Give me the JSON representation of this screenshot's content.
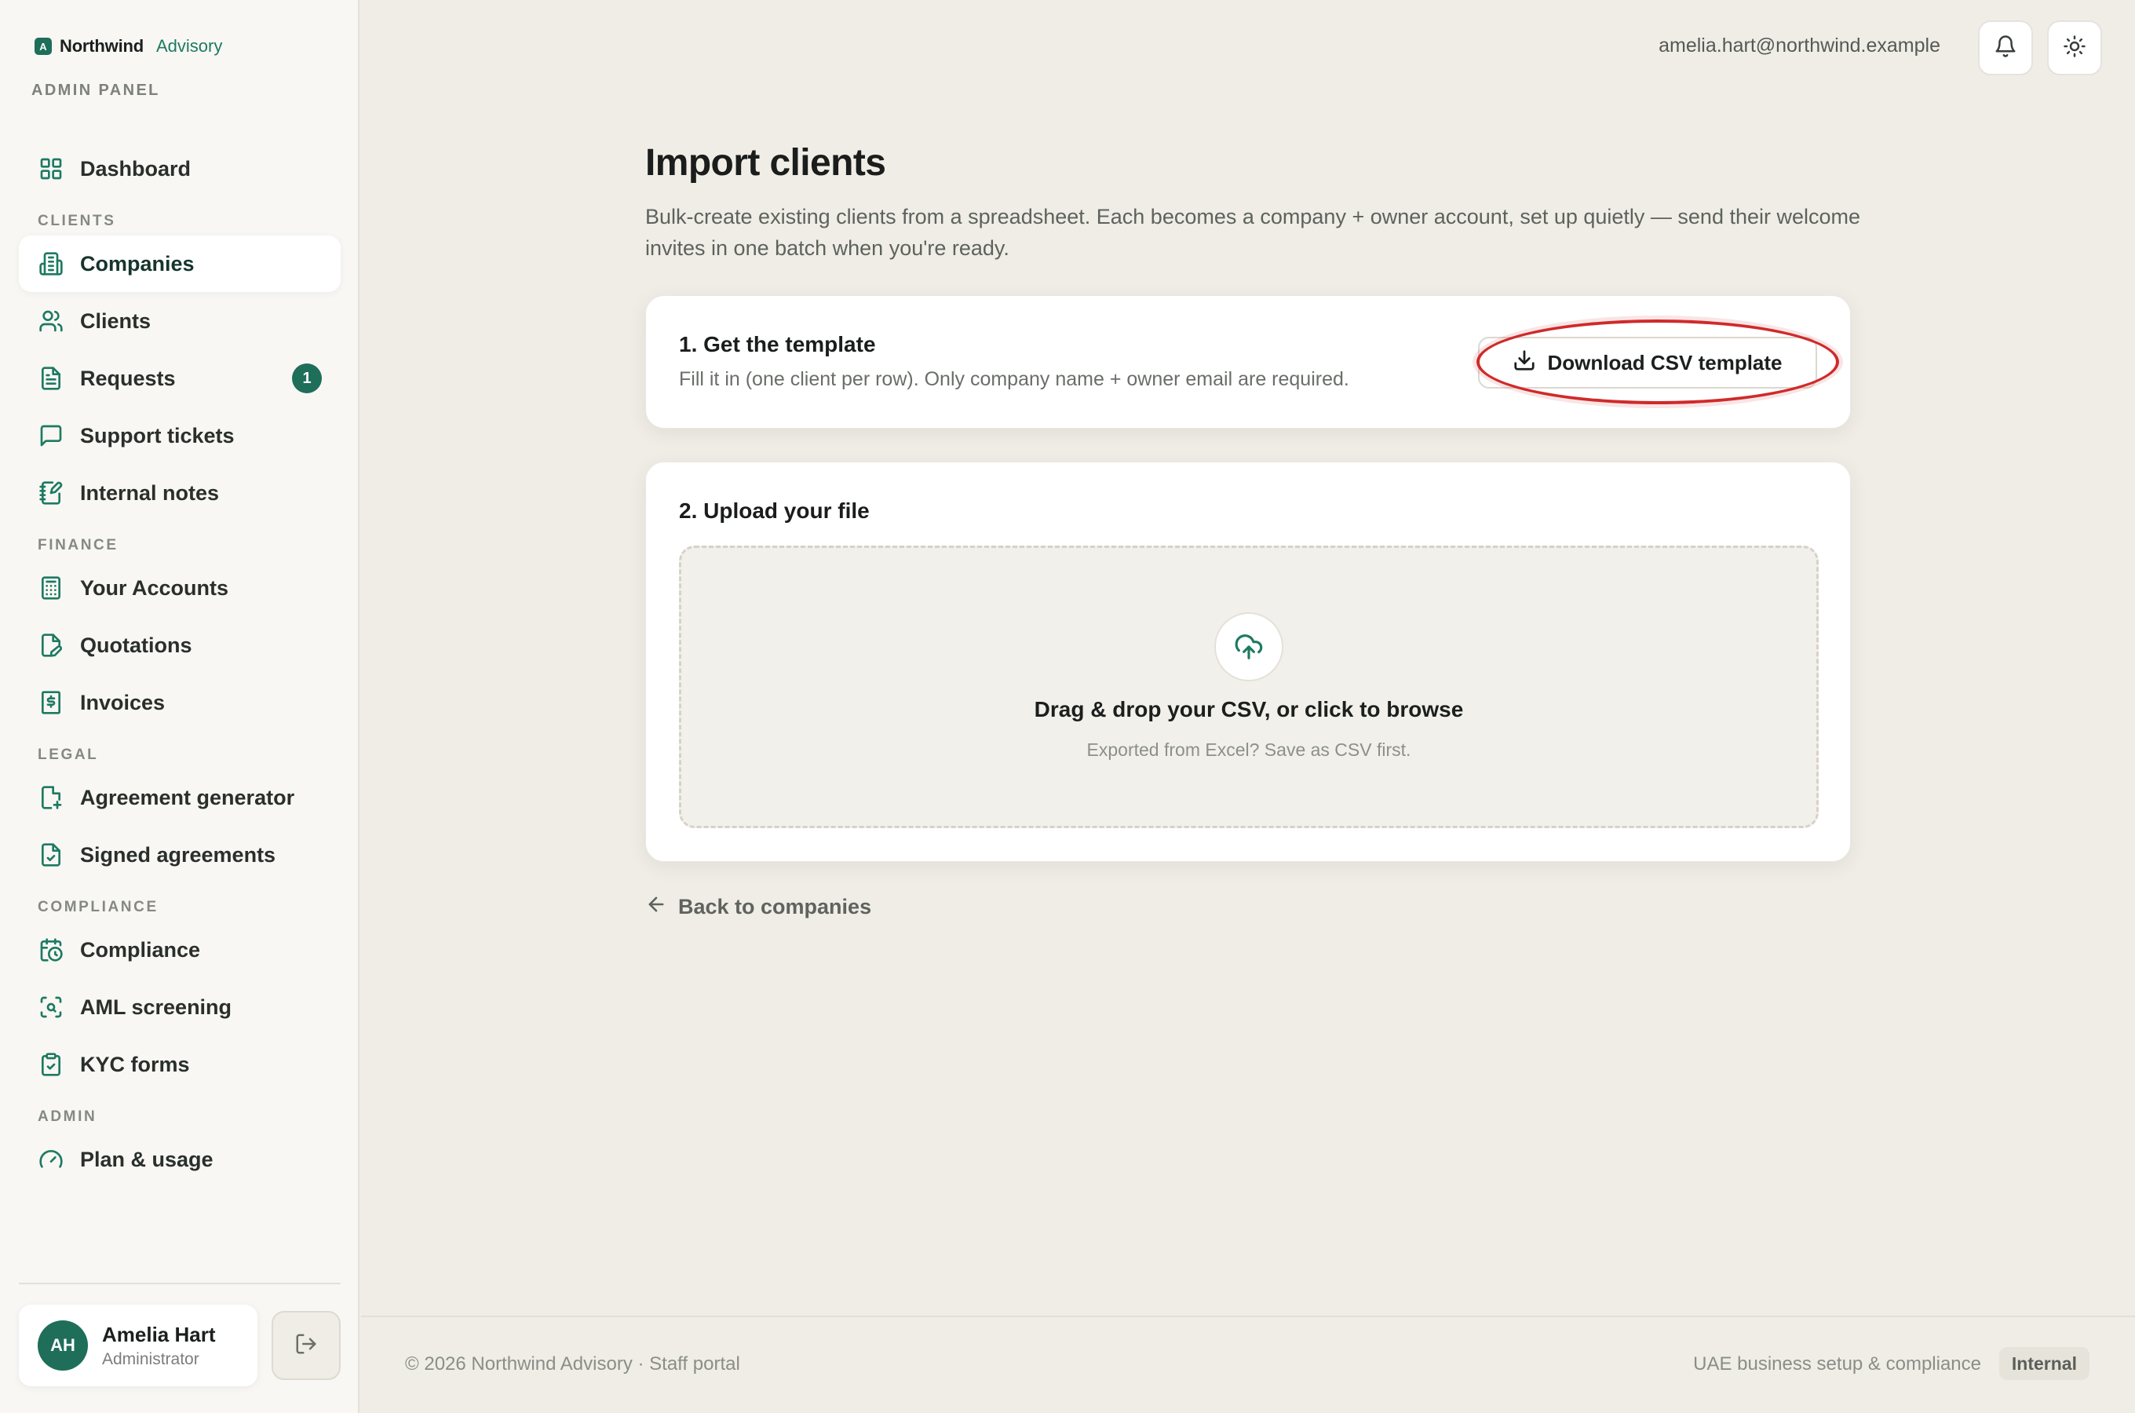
{
  "brand": {
    "name": "Northwind",
    "sub": "Advisory",
    "logo_letter": "A",
    "panel_label": "ADMIN PANEL"
  },
  "sidebar": {
    "sections": [
      {
        "label": "",
        "items": [
          {
            "label": "Dashboard",
            "icon": "dashboard-grid-icon"
          }
        ]
      },
      {
        "label": "CLIENTS",
        "items": [
          {
            "label": "Companies",
            "icon": "building-icon",
            "active": true
          },
          {
            "label": "Clients",
            "icon": "users-icon"
          },
          {
            "label": "Requests",
            "icon": "document-icon",
            "badge": "1"
          },
          {
            "label": "Support tickets",
            "icon": "message-square-icon"
          },
          {
            "label": "Internal notes",
            "icon": "notebook-pen-icon"
          }
        ]
      },
      {
        "label": "FINANCE",
        "items": [
          {
            "label": "Your Accounts",
            "icon": "calculator-icon"
          },
          {
            "label": "Quotations",
            "icon": "file-pen-icon"
          },
          {
            "label": "Invoices",
            "icon": "receipt-dollar-icon"
          }
        ]
      },
      {
        "label": "LEGAL",
        "items": [
          {
            "label": "Agreement generator",
            "icon": "file-plus-icon"
          },
          {
            "label": "Signed agreements",
            "icon": "file-check-icon"
          }
        ]
      },
      {
        "label": "COMPLIANCE",
        "items": [
          {
            "label": "Compliance",
            "icon": "calendar-clock-icon"
          },
          {
            "label": "AML screening",
            "icon": "scan-search-icon"
          },
          {
            "label": "KYC forms",
            "icon": "clipboard-check-icon"
          }
        ]
      },
      {
        "label": "ADMIN",
        "items": [
          {
            "label": "Plan & usage",
            "icon": "gauge-icon"
          }
        ]
      }
    ],
    "user": {
      "initials": "AH",
      "name": "Amelia Hart",
      "role": "Administrator"
    }
  },
  "topbar": {
    "email": "amelia.hart@northwind.example"
  },
  "main": {
    "title": "Import clients",
    "description": "Bulk-create existing clients from a spreadsheet. Each becomes a company + owner account, set up quietly — send their welcome invites in one batch when you're ready.",
    "step1": {
      "title": "1. Get the template",
      "subtitle": "Fill it in (one client per row). Only company name + owner email are required.",
      "button": "Download CSV template"
    },
    "step2": {
      "title": "2. Upload your file",
      "drop_main": "Drag & drop your CSV, or click to browse",
      "drop_sub": "Exported from Excel? Save as CSV first."
    },
    "back_link": "Back to companies"
  },
  "footer": {
    "left": "© 2026 Northwind Advisory · Staff portal",
    "right": "UAE business setup & compliance",
    "badge": "Internal"
  },
  "colors": {
    "accent": "#1e6e5a",
    "highlight": "#d02a2a",
    "background": "#efede6"
  }
}
